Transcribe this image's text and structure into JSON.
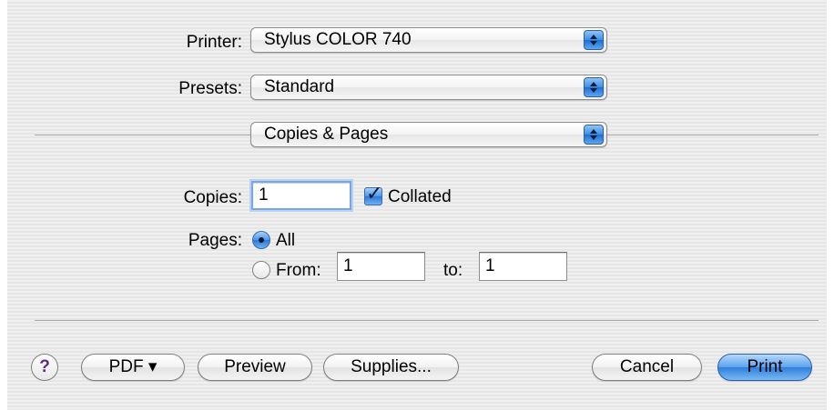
{
  "printer": {
    "label": "Printer:",
    "value": "Stylus COLOR 740"
  },
  "presets": {
    "label": "Presets:",
    "value": "Standard"
  },
  "panel": {
    "value": "Copies & Pages"
  },
  "copies": {
    "label": "Copies:",
    "value": "1",
    "collated_label": "Collated",
    "collated_checked": true
  },
  "pages": {
    "label": "Pages:",
    "all_label": "All",
    "from_label": "From:",
    "from_value": "1",
    "to_label": "to:",
    "to_value": "1",
    "selected": "All"
  },
  "buttons": {
    "help": "?",
    "pdf": "PDF ▾",
    "preview": "Preview",
    "supplies": "Supplies...",
    "cancel": "Cancel",
    "print": "Print"
  },
  "colors": {
    "accent": "#3d8ee6",
    "background": "#ececec"
  }
}
